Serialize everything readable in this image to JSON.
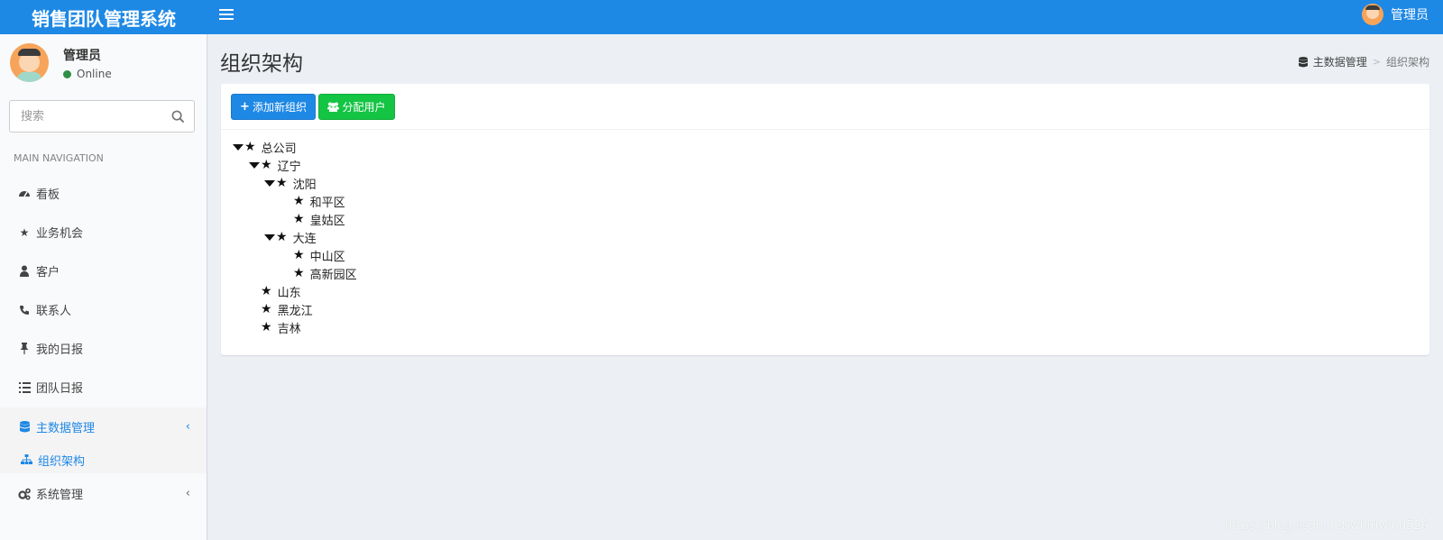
{
  "header": {
    "app_title": "销售团队管理系统",
    "user_name": "管理员"
  },
  "sidebar": {
    "user": {
      "name": "管理员",
      "status": "Online"
    },
    "search": {
      "placeholder": "搜索"
    },
    "nav_header": "MAIN NAVIGATION",
    "items": [
      {
        "label": "看板",
        "icon": "dashboard-icon"
      },
      {
        "label": "业务机会",
        "icon": "star-icon"
      },
      {
        "label": "客户",
        "icon": "user-tie-icon"
      },
      {
        "label": "联系人",
        "icon": "phone-icon"
      },
      {
        "label": "我的日报",
        "icon": "thumbtack-icon"
      },
      {
        "label": "团队日报",
        "icon": "list-icon"
      },
      {
        "label": "主数据管理",
        "icon": "database-icon",
        "active": true,
        "sub": [
          {
            "label": "组织架构",
            "icon": "sitemap-icon"
          }
        ]
      },
      {
        "label": "系统管理",
        "icon": "cogs-icon"
      }
    ]
  },
  "content": {
    "page_title": "组织架构",
    "breadcrumb": [
      "主数据管理",
      "组织架构"
    ],
    "buttons": {
      "add_org": "添加新组织",
      "assign_user": "分配用户"
    },
    "tree": [
      {
        "label": "总公司",
        "level": 0,
        "expanded": true
      },
      {
        "label": "辽宁",
        "level": 1,
        "expanded": true
      },
      {
        "label": "沈阳",
        "level": 2,
        "expanded": true
      },
      {
        "label": "和平区",
        "level": 3
      },
      {
        "label": "皇姑区",
        "level": 3
      },
      {
        "label": "大连",
        "level": 2,
        "expanded": true
      },
      {
        "label": "中山区",
        "level": 3
      },
      {
        "label": "高新园区",
        "level": 3
      },
      {
        "label": "山东",
        "level": 1
      },
      {
        "label": "黑龙江",
        "level": 1
      },
      {
        "label": "吉林",
        "level": 1
      }
    ]
  },
  "watermark": "https://blog.csdn.net/whirlwind526",
  "colors": {
    "primary": "#1e88e5",
    "success": "#14c443",
    "background": "#ecf0f5",
    "sidebar": "#f9fafc"
  }
}
